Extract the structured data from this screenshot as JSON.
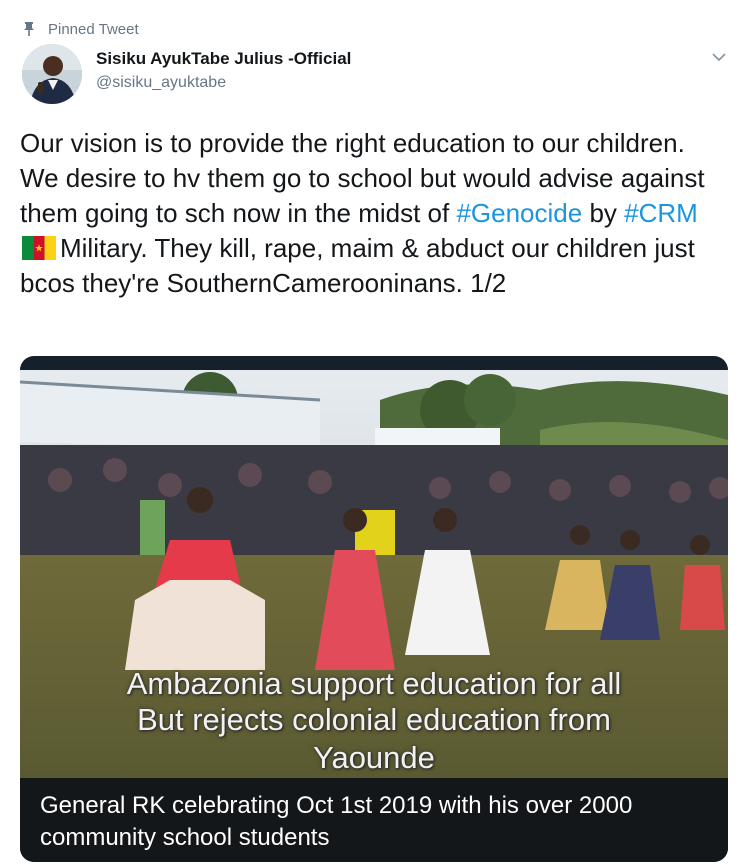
{
  "pinned_label": "Pinned Tweet",
  "author": {
    "name": "Sisiku AyukTabe Julius -Official",
    "handle": "@sisiku_ayuktabe"
  },
  "tweet": {
    "part1": "Our vision is to provide the right education to our children. We desire to hv them go to school but would advise against them going to sch now in the midst of ",
    "hashtag1": "#Genocide",
    "part2": " by ",
    "hashtag2": "#CRM",
    "part3": "Military. They kill, rape, maim & abduct our children just bcos they're SouthernCamerooninans. 1/2"
  },
  "media": {
    "overlay_line1": "Ambazonia support education for all",
    "overlay_line2": "But rejects colonial education from",
    "overlay_line3": "Yaounde",
    "caption": "General RK celebrating Oct 1st 2019 with his over 2000 community school students"
  },
  "colors": {
    "link": "#1b95e0",
    "muted": "#657786",
    "caption_bg": "#14171a"
  }
}
